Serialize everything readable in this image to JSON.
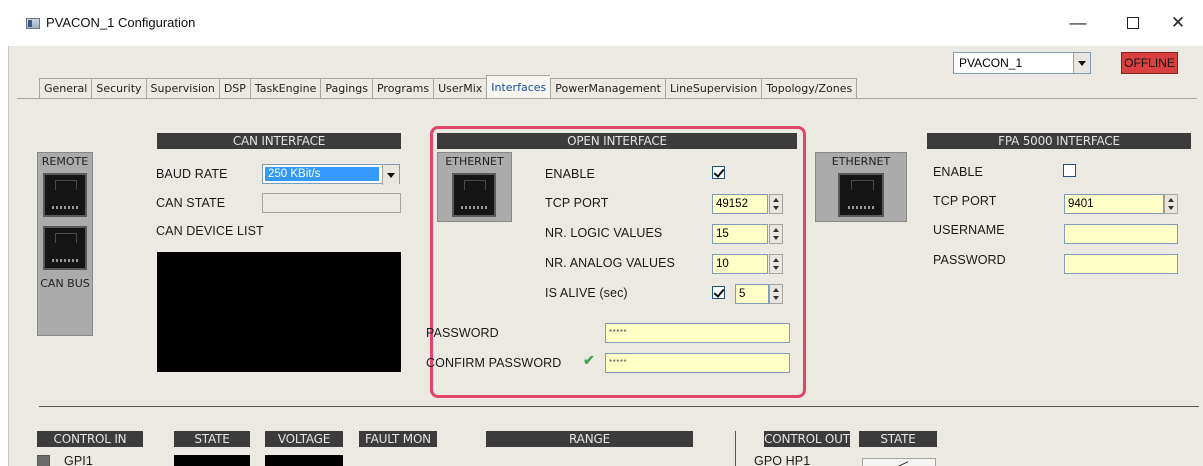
{
  "window": {
    "title": "PVACON_1 Configuration",
    "minimize": "—",
    "close": "✕"
  },
  "device": {
    "selected": "PVACON_1",
    "status": "OFFLINE"
  },
  "tabs": [
    {
      "label": "General"
    },
    {
      "label": "Security"
    },
    {
      "label": "Supervision"
    },
    {
      "label": "DSP"
    },
    {
      "label": "TaskEngine"
    },
    {
      "label": "Pagings"
    },
    {
      "label": "Programs"
    },
    {
      "label": "UserMix"
    },
    {
      "label": "Interfaces",
      "active": true
    },
    {
      "label": "PowerManagement"
    },
    {
      "label": "LineSupervision"
    },
    {
      "label": "Topology/Zones"
    }
  ],
  "can": {
    "header": "CAN INTERFACE",
    "remote_label": "REMOTE",
    "bus_label": "CAN BUS",
    "baud_rate_label": "BAUD RATE",
    "baud_rate_value": "250 KBit/s",
    "can_state_label": "CAN STATE",
    "can_state_value": "",
    "device_list_label": "CAN DEVICE LIST"
  },
  "open": {
    "header": "OPEN INTERFACE",
    "ethernet_label": "ETHERNET",
    "enable_label": "ENABLE",
    "enable_checked": true,
    "tcp_port_label": "TCP PORT",
    "tcp_port_value": "49152",
    "logic_label": "NR. LOGIC VALUES",
    "logic_value": "15",
    "analog_label": "NR. ANALOG VALUES",
    "analog_value": "10",
    "alive_label": "IS ALIVE (sec)",
    "alive_checked": true,
    "alive_value": "5",
    "password_label": "PASSWORD",
    "password_value": "*****",
    "confirm_label": "CONFIRM PASSWORD",
    "confirm_value": "*****"
  },
  "fpa": {
    "header": "FPA 5000 INTERFACE",
    "ethernet_label": "ETHERNET",
    "enable_label": "ENABLE",
    "enable_checked": false,
    "tcp_port_label": "TCP PORT",
    "tcp_port_value": "9401",
    "username_label": "USERNAME",
    "username_value": "",
    "password_label": "PASSWORD",
    "password_value": ""
  },
  "bottom": {
    "control_in": "CONTROL IN",
    "state": "STATE",
    "voltage": "VOLTAGE",
    "fault_mon": "FAULT MON",
    "range": "RANGE",
    "control_out": "CONTROL OUT",
    "out_state": "STATE",
    "gpi1": "GPI1",
    "gpo_hp1": "GPO HP1"
  }
}
